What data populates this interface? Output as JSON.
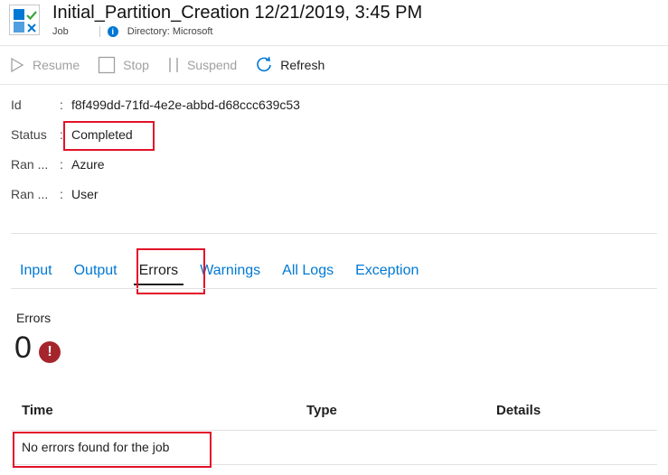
{
  "header": {
    "title": "Initial_Partition_Creation 12/21/2019, 3:45 PM",
    "type": "Job",
    "directory": "Directory: Microsoft",
    "icon": "job-icon",
    "info_icon_glyph": "i"
  },
  "toolbar": {
    "resume": "Resume",
    "stop": "Stop",
    "suspend": "Suspend",
    "refresh": "Refresh"
  },
  "properties": {
    "rows": [
      {
        "key": "Id",
        "value": "f8f499dd-71fd-4e2e-abbd-d68ccc639c53"
      },
      {
        "key": "Status",
        "value": "Completed"
      },
      {
        "key": "Ran ...",
        "value": "Azure"
      },
      {
        "key": "Ran ...",
        "value": "User"
      }
    ],
    "separator": ":"
  },
  "tabs": [
    {
      "label": "Input",
      "active": false
    },
    {
      "label": "Output",
      "active": false
    },
    {
      "label": "Errors",
      "active": true
    },
    {
      "label": "Warnings",
      "active": false
    },
    {
      "label": "All Logs",
      "active": false
    },
    {
      "label": "Exception",
      "active": false
    }
  ],
  "errors": {
    "label": "Errors",
    "count": "0",
    "icon_glyph": "!",
    "table": {
      "columns": [
        "Time",
        "Type",
        "Details"
      ],
      "empty_message": "No errors found for the job"
    }
  },
  "colors": {
    "accent": "#0078d4",
    "highlight": "#e3122a",
    "error": "#a4262c"
  }
}
